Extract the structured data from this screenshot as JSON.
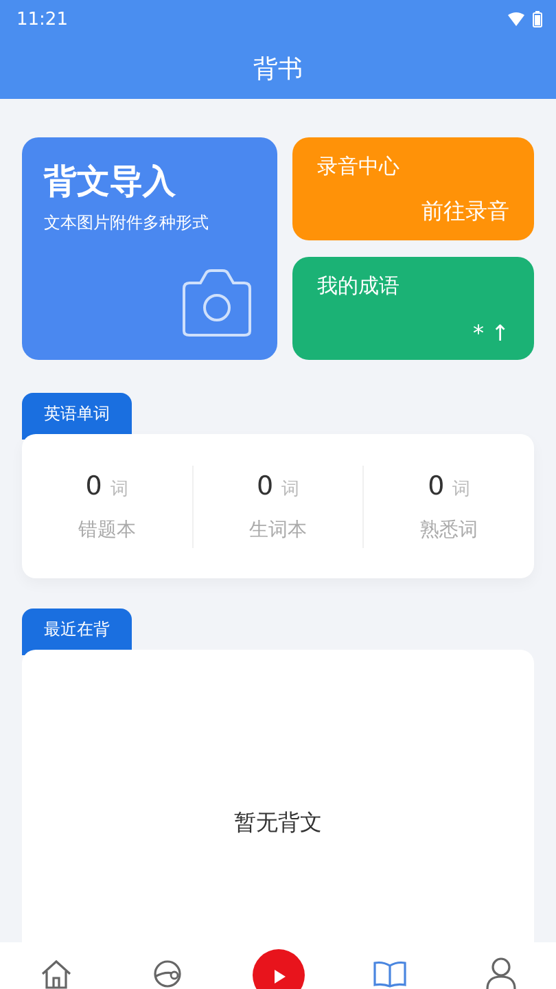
{
  "status_bar": {
    "time": "11:21"
  },
  "header": {
    "title": "背书"
  },
  "import_card": {
    "title": "背文导入",
    "subtitle": "文本图片附件多种形式"
  },
  "record_card": {
    "title": "录音中心",
    "action": "前往录音"
  },
  "idiom_card": {
    "title": "我的成语",
    "action": "* ↑"
  },
  "english_words": {
    "tag": "英语单词",
    "stats": [
      {
        "count": "0",
        "unit": "词",
        "label": "错题本"
      },
      {
        "count": "0",
        "unit": "词",
        "label": "生词本"
      },
      {
        "count": "0",
        "unit": "词",
        "label": "熟悉词"
      }
    ]
  },
  "recent": {
    "tag": "最近在背",
    "empty_text": "暂无背文"
  },
  "bottom_nav": [
    {
      "kind": "home",
      "selected": false
    },
    {
      "kind": "planet",
      "selected": false
    },
    {
      "kind": "play",
      "selected": false
    },
    {
      "kind": "book",
      "selected": true
    },
    {
      "kind": "profile",
      "selected": false
    }
  ]
}
